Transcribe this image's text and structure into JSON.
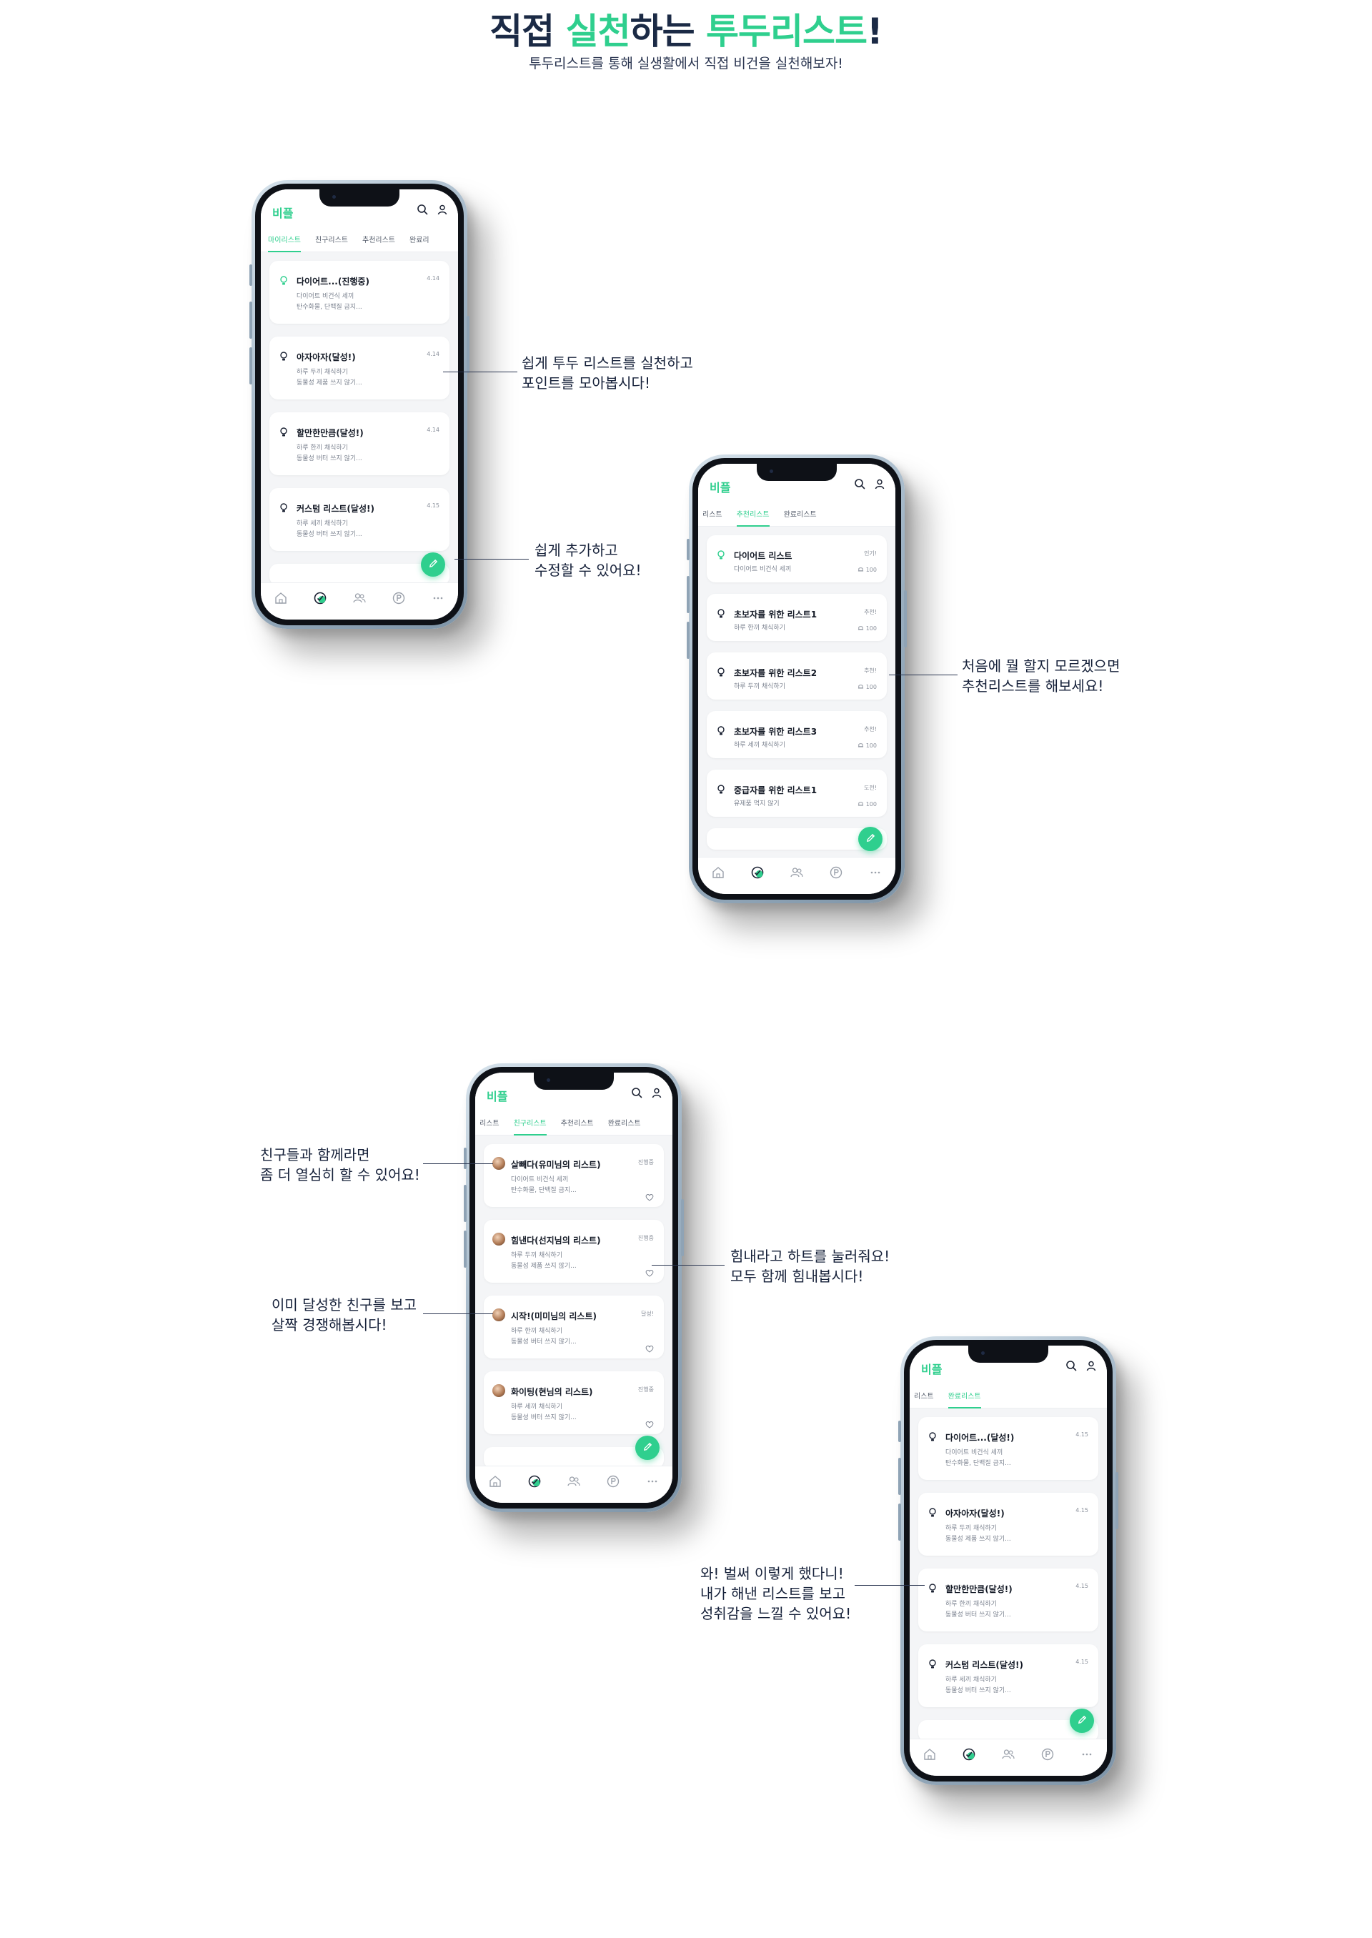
{
  "hero": {
    "title_parts": [
      "직접 ",
      "실천",
      "하는 ",
      "투두리스트",
      "!"
    ],
    "subtitle": "투두리스트를 통해 실생활에서 직접 비건을 실천해보자!"
  },
  "colors": {
    "accent": "#2fcf8e",
    "navy": "#1b2a45",
    "card_bg": "#ffffff",
    "screen_bg": "#f4f5f7"
  },
  "app": {
    "logo": "비플"
  },
  "phones": [
    {
      "tabs": [
        "마이리스트",
        "친구리스트",
        "추천리스트",
        "완료리"
      ],
      "active_tab": 0,
      "cards": [
        {
          "title": "다이어트...(진행중)",
          "date": "4.14",
          "line1": "다이어트 비건식 세끼",
          "line2": "탄수화물, 단백질 금지..."
        },
        {
          "title": "아자아자(달성!)",
          "date": "4.14",
          "line1": "하루 두끼 채식하기",
          "line2": "동물성 제품 쓰지 않기..."
        },
        {
          "title": "할만한만큼(달성!)",
          "date": "4.14",
          "line1": "하루 한끼 채식하기",
          "line2": "동물성 버터 쓰지 않기..."
        },
        {
          "title": "커스텀 리스트(달성!)",
          "date": "4.15",
          "line1": "하루 세끼 채식하기",
          "line2": "동물성 버터 쓰지 않기..."
        }
      ]
    },
    {
      "tabs": [
        "리스트",
        "추천리스트",
        "완료리스트"
      ],
      "active_tab": 1,
      "cards": [
        {
          "title": "다이어트 리스트",
          "date": "인기!",
          "line1": "다이어트 비건식 세끼",
          "count": "100"
        },
        {
          "title": "초보자를 위한 리스트1",
          "date": "추천!",
          "line1": "하루 한끼 채식하기",
          "count": "100"
        },
        {
          "title": "초보자를 위한 리스트2",
          "date": "추천!",
          "line1": "하루 두끼 채식하기",
          "count": "100"
        },
        {
          "title": "초보자를 위한 리스트3",
          "date": "추천!",
          "line1": "하루 세끼 채식하기",
          "count": "100"
        },
        {
          "title": "중급자를 위한 리스트1",
          "date": "도전!",
          "line1": "유제품 먹지 않기",
          "count": "100"
        }
      ]
    },
    {
      "tabs": [
        "리스트",
        "친구리스트",
        "추천리스트",
        "완료리스트"
      ],
      "active_tab": 1,
      "cards": [
        {
          "title": "살빼다(유미님의 리스트)",
          "date": "진행중",
          "line1": "다이어트 비건식 세끼",
          "line2": "탄수화물, 단백질 금지..."
        },
        {
          "title": "힘낸다(선지님의 리스트)",
          "date": "진행중",
          "line1": "하루 두끼 채식하기",
          "line2": "동물성 제품 쓰지 않기..."
        },
        {
          "title": "시작!(미미님의 리스트)",
          "date": "달성!",
          "line1": "하루 한끼 채식하기",
          "line2": "동물성 버터 쓰지 않기..."
        },
        {
          "title": "화이팅(현님의 리스트)",
          "date": "진행중",
          "line1": "하루 세끼 채식하기",
          "line2": "동물성 버터 쓰지 않기..."
        }
      ]
    },
    {
      "tabs": [
        "리스트",
        "완료리스트"
      ],
      "active_tab": 1,
      "cards": [
        {
          "title": "다이어트...(달성!)",
          "date": "4.15",
          "line1": "다이어트 비건식 세끼",
          "line2": "탄수화물, 단백질 금지..."
        },
        {
          "title": "아자아자(달성!)",
          "date": "4.15",
          "line1": "하루 두끼 채식하기",
          "line2": "동물성 제품 쓰지 않기..."
        },
        {
          "title": "할만한만큼(달성!)",
          "date": "4.15",
          "line1": "하루 한끼 채식하기",
          "line2": "동물성 버터 쓰지 않기..."
        },
        {
          "title": "커스텀 리스트(달성!)",
          "date": "4.15",
          "line1": "하루 세끼 채식하기",
          "line2": "동물성 버터 쓰지 않기..."
        }
      ]
    }
  ],
  "callouts": {
    "c1": [
      "쉽게 투두 리스트를 실천하고",
      "포인트를 모아봅시다!"
    ],
    "c2": [
      "쉽게 추가하고",
      "수정할 수 있어요!"
    ],
    "c3": [
      "처음에 뭘 할지 모르겠으면",
      "추천리스트를 해보세요!"
    ],
    "c4": [
      "친구들과 함께라면",
      "좀 더 열심히 할 수 있어요!"
    ],
    "c5": [
      "힘내라고 하트를 눌러줘요!",
      "모두 함께 힘내봅시다!"
    ],
    "c6": [
      "이미 달성한 친구를 보고",
      "살짝 경쟁해봅시다!"
    ],
    "c7": [
      "와! 벌써 이렇게 했다니!",
      "내가 해낸 리스트를 보고",
      "성취감을 느낄 수 있어요!"
    ]
  },
  "icons": {
    "header": [
      "search-icon",
      "user-icon"
    ],
    "card": [
      "bulb-icon",
      "bell-icon",
      "heart-icon",
      "avatar"
    ],
    "fab": "pencil-icon",
    "nav": [
      "home-icon",
      "todo-icon",
      "friends-icon",
      "point-icon",
      "more-icon"
    ]
  }
}
